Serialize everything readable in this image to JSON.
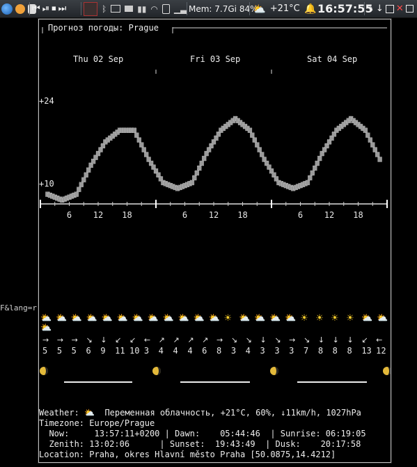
{
  "taskbar": {
    "media_prev": "⏮",
    "media_playpause": "⏯",
    "media_stop": "⏹",
    "media_next": "⏭",
    "memory_text": "Mem: 7.7Gi 84%",
    "weather_icon": "cloud-sun-icon",
    "temperature": "+21°C",
    "bell_icon": "bell-icon",
    "clock": "16:57:55",
    "window_buttons": [
      "pin-icon",
      "minimize-icon",
      "maximize-icon",
      "close-icon",
      "restore-icon"
    ]
  },
  "background_text": "F&lang=ru",
  "weather": {
    "title": "Прогноз погоды: Prague",
    "days": [
      "Thu 02 Sep",
      "Fri 03 Sep",
      "Sat 04 Sep"
    ],
    "y_labels": [
      "+24",
      "+10"
    ],
    "hour_ticks": [
      "6",
      "12",
      "18"
    ],
    "icons": [
      "⛅",
      "⛅",
      "⛅",
      "⛅",
      "⛅",
      "⛅",
      "⛅",
      "⛅",
      "⛅",
      "⛅",
      "⛅",
      "⛅",
      "☀",
      "⛅",
      "⛅",
      "⛅",
      "⛅",
      "☀",
      "☀",
      "☀",
      "☀",
      "⛅",
      "⛅",
      "⛅"
    ],
    "wind_arrows": [
      "→",
      "→",
      "→",
      "↘",
      "↓",
      "↙",
      "↙",
      "←",
      "↗",
      "↗",
      "↗",
      "↗",
      "→",
      "↘",
      "↘",
      "↓",
      "↘",
      "→",
      "↘",
      "↓",
      "↓",
      "↓",
      "↙",
      "←"
    ],
    "wind_speeds": [
      "5",
      "5",
      "5",
      "6",
      "9",
      "11",
      "10",
      "3",
      "4",
      "4",
      "4",
      "6",
      "8",
      "3",
      "4",
      "3",
      "3",
      "3",
      "7",
      "8",
      "8",
      "8",
      "13",
      "12"
    ],
    "moon_icon": "moon-phase-icon",
    "details": {
      "weather_label": "Weather:",
      "weather_icon": "⛅",
      "weather_text": "Переменная облачность, +21°C, 60%, ↓11km/h, 1027hPa",
      "timezone_line": "Timezone: Europe/Prague",
      "now_line": "  Now:     13:57:11+0200 | Dawn:    05:44:46  | Sunrise: 06:19:05",
      "zenith_line": "  Zenith: 13:02:06      | Sunset:  19:43:49  | Dusk:    20:17:58",
      "location_line": "Location: Praha, okres Hlavní město Praha [50.0875,14.4212]"
    }
  },
  "chart_data": {
    "type": "line",
    "title": "",
    "xlabel": "",
    "ylabel": "",
    "x": [
      "Thu 02 Sep 00h",
      "Thu 02 Sep 03h",
      "Thu 02 Sep 06h",
      "Thu 02 Sep 09h",
      "Thu 02 Sep 12h",
      "Thu 02 Sep 15h",
      "Thu 02 Sep 18h",
      "Thu 02 Sep 21h",
      "Fri 03 Sep 00h",
      "Fri 03 Sep 03h",
      "Fri 03 Sep 06h",
      "Fri 03 Sep 09h",
      "Fri 03 Sep 12h",
      "Fri 03 Sep 15h",
      "Fri 03 Sep 18h",
      "Fri 03 Sep 21h",
      "Sat 04 Sep 00h",
      "Sat 04 Sep 03h",
      "Sat 04 Sep 06h",
      "Sat 04 Sep 09h",
      "Sat 04 Sep 12h",
      "Sat 04 Sep 15h",
      "Sat 04 Sep 18h",
      "Sat 04 Sep 21h"
    ],
    "series": [
      {
        "values": [
          11,
          10,
          11,
          16,
          20,
          22,
          22,
          17,
          13,
          12,
          13,
          18,
          22,
          24,
          22,
          17,
          13,
          12,
          13,
          18,
          22,
          24,
          22,
          17
        ]
      }
    ],
    "ylim": [
      10,
      24
    ],
    "grid": false,
    "legend": "none"
  }
}
